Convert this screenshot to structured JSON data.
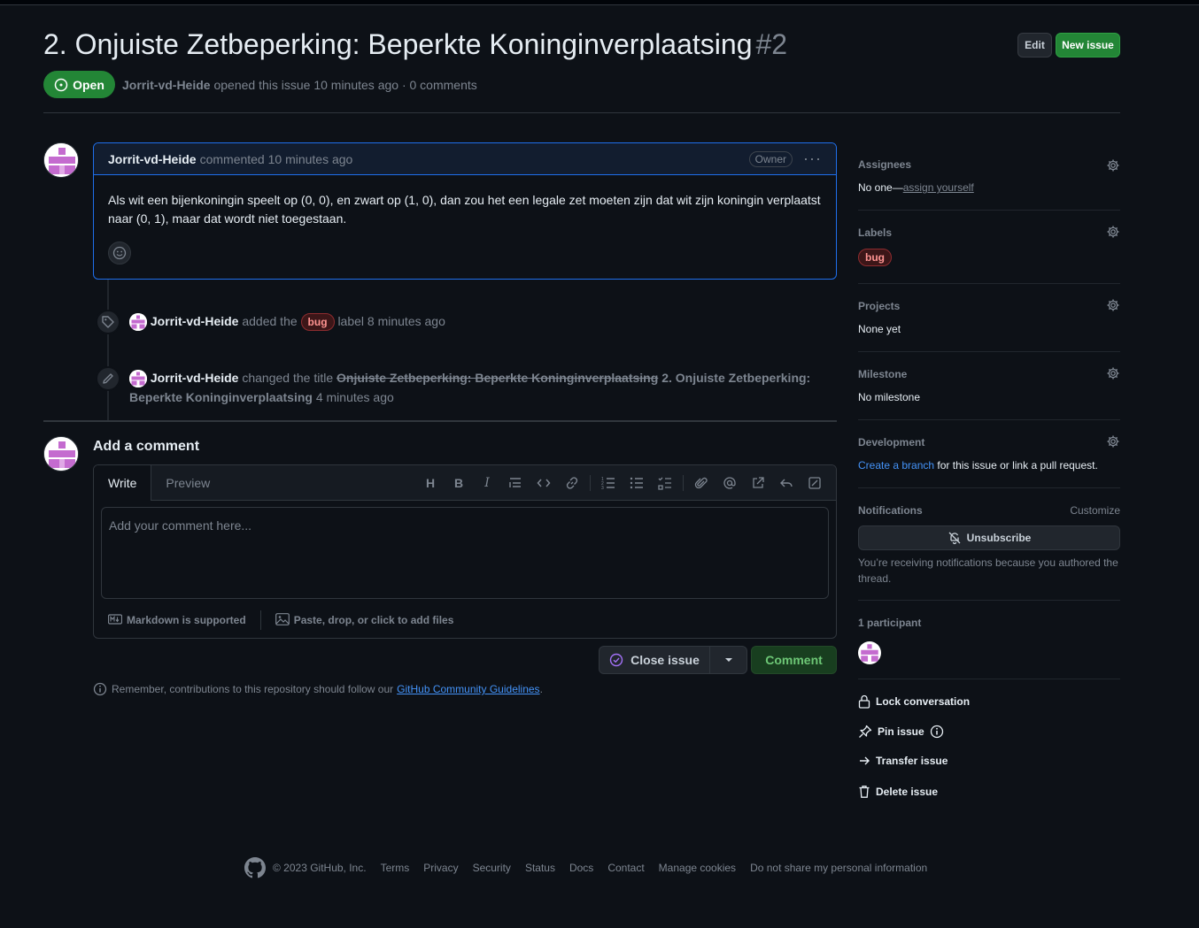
{
  "issue": {
    "title": "2. Onjuiste Zetbeperking: Beperkte Koninginverplaatsing",
    "number": "#2",
    "state": "Open",
    "author": "Jorrit-vd-Heide",
    "meta_rest": "opened this issue 10 minutes ago · 0 comments"
  },
  "header_buttons": {
    "edit": "Edit",
    "new_issue": "New issue"
  },
  "comment": {
    "author": "Jorrit-vd-Heide",
    "action": "commented 10 minutes ago",
    "role": "Owner",
    "body": "Als wit een bijenkoningin speelt op (0, 0), en zwart op (1, 0), dan zou het een legale zet moeten zijn dat wit zijn koningin verplaatst naar (0, 1), maar dat wordt niet toegestaan."
  },
  "timeline": {
    "label_event": {
      "actor": "Jorrit-vd-Heide",
      "pre": "added the",
      "label": "bug",
      "post": "label 8 minutes ago"
    },
    "rename_event": {
      "actor": "Jorrit-vd-Heide",
      "pre": "changed the title",
      "old_title": "Onjuiste Zetbeperking: Beperkte Koninginverplaatsing",
      "new_title": "2. Onjuiste Zetbeperking: Beperkte Koninginverplaatsing",
      "post": "4 minutes ago"
    }
  },
  "new_comment": {
    "heading": "Add a comment",
    "tab_write": "Write",
    "tab_preview": "Preview",
    "placeholder": "Add your comment here...",
    "markdown": "Markdown is supported",
    "attach": "Paste, drop, or click to add files",
    "close_issue": "Close issue",
    "comment": "Comment",
    "remember_pre": "Remember, contributions to this repository should follow our",
    "remember_link": "GitHub Community Guidelines",
    "remember_post": "."
  },
  "sidebar": {
    "assignees": {
      "heading": "Assignees",
      "value_pre": "No one—",
      "value_link": "assign yourself"
    },
    "labels": {
      "heading": "Labels",
      "label": "bug"
    },
    "projects": {
      "heading": "Projects",
      "value": "None yet"
    },
    "milestone": {
      "heading": "Milestone",
      "value": "No milestone"
    },
    "development": {
      "heading": "Development",
      "link": "Create a branch",
      "rest": "for this issue or link a pull request."
    },
    "notifications": {
      "heading": "Notifications",
      "customize": "Customize",
      "unsubscribe": "Unsubscribe",
      "reason": "You’re receiving notifications because you authored the thread."
    },
    "participants": {
      "heading": "1 participant"
    },
    "actions": {
      "lock": "Lock conversation",
      "pin": "Pin issue",
      "transfer": "Transfer issue",
      "delete": "Delete issue"
    }
  },
  "footer": {
    "copyright": "© 2023 GitHub, Inc.",
    "links": [
      "Terms",
      "Privacy",
      "Security",
      "Status",
      "Docs",
      "Contact",
      "Manage cookies",
      "Do not share my personal information"
    ]
  },
  "colors": {
    "accent": "#1f6feb",
    "open_green": "#238636",
    "link": "#4493f8",
    "bug_label": "#ff9492",
    "background": "#0d1117"
  }
}
